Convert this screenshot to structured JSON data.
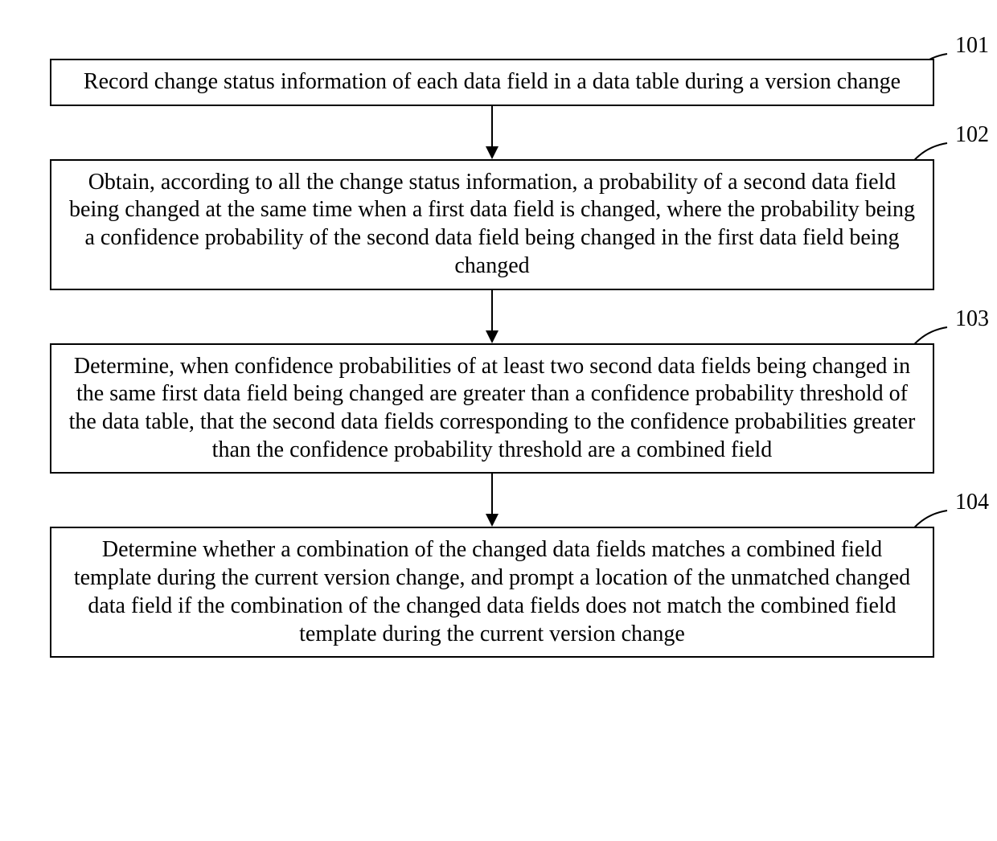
{
  "steps": [
    {
      "id": "101",
      "text": "Record change status information of each data field in a data table during a version change"
    },
    {
      "id": "102",
      "text": "Obtain, according to all the change status information, a probability of a second data field being changed at the same time when a first data field is changed, where the probability being a confidence probability of the second data field being changed in the first data field being changed"
    },
    {
      "id": "103",
      "text": "Determine, when confidence probabilities of at least two second data fields being changed in the same first data field being changed are greater than a confidence probability threshold of the data table, that the second data fields corresponding to the confidence probabilities greater than the confidence probability threshold are a combined field"
    },
    {
      "id": "104",
      "text": "Determine whether a combination of the changed data fields matches a combined field template during the current version change, and prompt a location of the unmatched changed data field if the combination of the changed data fields does not match the combined field template during the current version change"
    }
  ],
  "chart_data": {
    "type": "flowchart",
    "direction": "top-down",
    "nodes": [
      {
        "id": "101",
        "label": "Record change status information of each data field in a data table during a version change"
      },
      {
        "id": "102",
        "label": "Obtain, according to all the change status information, a probability of a second data field being changed at the same time when a first data field is changed, where the probability being a confidence probability of the second data field being changed in the first data field being changed"
      },
      {
        "id": "103",
        "label": "Determine, when confidence probabilities of at least two second data fields being changed in the same first data field being changed are greater than a confidence probability threshold of the data table, that the second data fields corresponding to the confidence probabilities greater than the confidence probability threshold are a combined field"
      },
      {
        "id": "104",
        "label": "Determine whether a combination of the changed data fields matches a combined field template during the current version change, and prompt a location of the unmatched changed data field if the combination of the changed data fields does not match the combined field template during the current version change"
      }
    ],
    "edges": [
      {
        "from": "101",
        "to": "102"
      },
      {
        "from": "102",
        "to": "103"
      },
      {
        "from": "103",
        "to": "104"
      }
    ]
  }
}
